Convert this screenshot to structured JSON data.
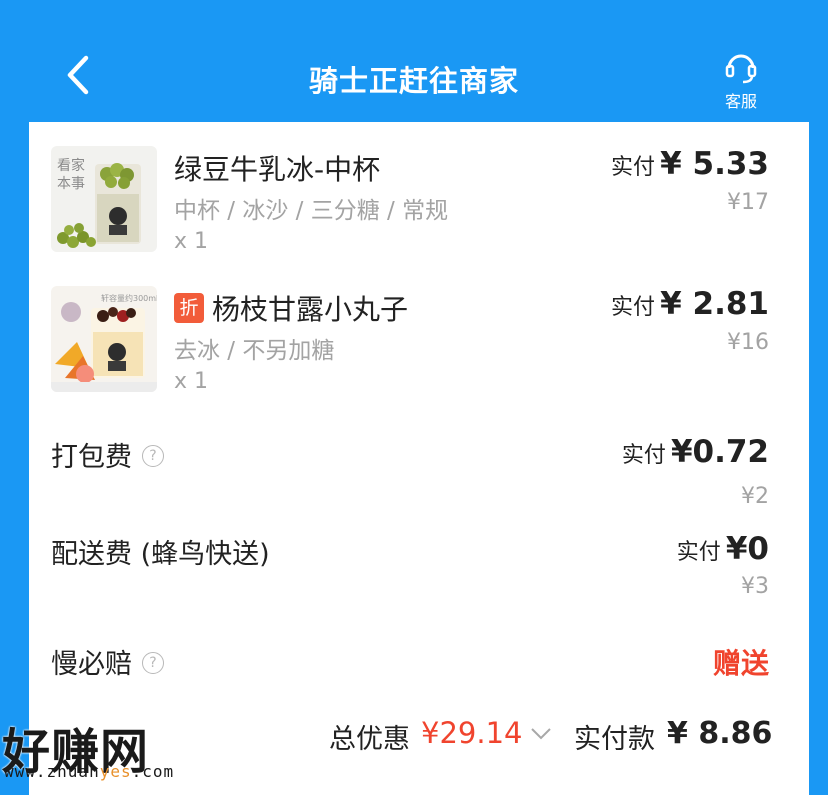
{
  "header": {
    "title": "骑士正赶往商家",
    "service_label": "客服"
  },
  "items": [
    {
      "name": "绿豆牛乳冰-中杯",
      "spec": "中杯 / 冰沙 / 三分糖 / 常规",
      "qty": "x 1",
      "paid_label": "实付",
      "paid_value": "¥ 5.33",
      "original": "¥17",
      "thumb_text": "看家\n本事"
    },
    {
      "badge": "折",
      "name": "杨枝甘露小丸子",
      "spec": "去冰 / 不另加糖",
      "qty": "x 1",
      "paid_label": "实付",
      "paid_value": "¥ 2.81",
      "original": "¥16",
      "thumb_text": "轩容量约300ml"
    }
  ],
  "fees": {
    "packing_label": "打包费",
    "packing_paid_label": "实付",
    "packing_paid": "¥0.72",
    "packing_original": "¥2",
    "delivery_label": "配送费 (蜂鸟快送)",
    "delivery_paid_label": "实付",
    "delivery_paid": "¥0",
    "delivery_original": "¥3",
    "slow_label": "慢必赔",
    "slow_value": "赠送"
  },
  "footer": {
    "discount_label": "总优惠",
    "discount_value": "¥29.14",
    "pay_label": "实付款",
    "pay_value": "¥ 8.86"
  },
  "watermark": {
    "logo": "好赚网",
    "url_pre": "www.zhuan",
    "url_hl": "yes",
    "url_post": ".com"
  },
  "colors": {
    "header_bg": "#1a98f4",
    "accent_red": "#f0442e",
    "muted": "#a3a3a3"
  },
  "icons": {
    "back": "chevron-left-icon",
    "service": "headset-icon",
    "help": "question-circle-icon",
    "expand": "chevron-down-icon"
  }
}
